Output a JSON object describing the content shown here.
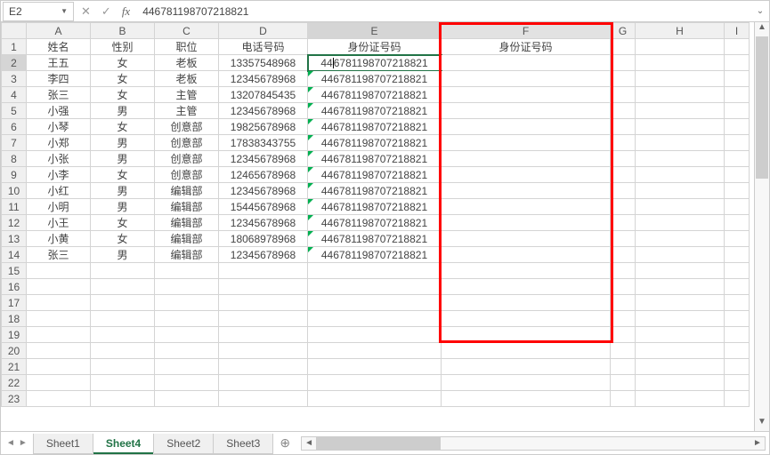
{
  "nameBox": "E2",
  "formula": "446781198707218821",
  "colHeaders": [
    "A",
    "B",
    "C",
    "D",
    "E",
    "F",
    "G",
    "H",
    "I"
  ],
  "rows": [
    {
      "n": 1,
      "A": "姓名",
      "B": "性别",
      "C": "职位",
      "D": "电话号码",
      "E": "身份证号码",
      "F": "身份证号码"
    },
    {
      "n": 2,
      "A": "王五",
      "B": "女",
      "C": "老板",
      "D": "13357548968",
      "E": "446781198707218821"
    },
    {
      "n": 3,
      "A": "李四",
      "B": "女",
      "C": "老板",
      "D": "12345678968",
      "E": "446781198707218821"
    },
    {
      "n": 4,
      "A": "张三",
      "B": "女",
      "C": "主管",
      "D": "13207845435",
      "E": "446781198707218821"
    },
    {
      "n": 5,
      "A": "小强",
      "B": "男",
      "C": "主管",
      "D": "12345678968",
      "E": "446781198707218821"
    },
    {
      "n": 6,
      "A": "小琴",
      "B": "女",
      "C": "创意部",
      "D": "19825678968",
      "E": "446781198707218821"
    },
    {
      "n": 7,
      "A": "小郑",
      "B": "男",
      "C": "创意部",
      "D": "17838343755",
      "E": "446781198707218821"
    },
    {
      "n": 8,
      "A": "小张",
      "B": "男",
      "C": "创意部",
      "D": "12345678968",
      "E": "446781198707218821"
    },
    {
      "n": 9,
      "A": "小李",
      "B": "女",
      "C": "创意部",
      "D": "12465678968",
      "E": "446781198707218821"
    },
    {
      "n": 10,
      "A": "小红",
      "B": "男",
      "C": "编辑部",
      "D": "12345678968",
      "E": "446781198707218821"
    },
    {
      "n": 11,
      "A": "小明",
      "B": "男",
      "C": "编辑部",
      "D": "15445678968",
      "E": "446781198707218821"
    },
    {
      "n": 12,
      "A": "小王",
      "B": "女",
      "C": "编辑部",
      "D": "12345678968",
      "E": "446781198707218821"
    },
    {
      "n": 13,
      "A": "小黄",
      "B": "女",
      "C": "编辑部",
      "D": "18068978968",
      "E": "446781198707218821"
    },
    {
      "n": 14,
      "A": "张三",
      "B": "男",
      "C": "编辑部",
      "D": "12345678968",
      "E": "446781198707218821"
    },
    {
      "n": 15
    },
    {
      "n": 16
    },
    {
      "n": 17
    },
    {
      "n": 18
    },
    {
      "n": 19
    },
    {
      "n": 20
    },
    {
      "n": 21
    },
    {
      "n": 22
    },
    {
      "n": 23
    }
  ],
  "active": {
    "row": 2,
    "col": "E"
  },
  "greenTriRows": [
    3,
    4,
    5,
    6,
    7,
    8,
    9,
    10,
    11,
    12,
    13,
    14
  ],
  "highlight": {
    "col": "F",
    "rowStart": 1,
    "rowEnd": 19
  },
  "tabs": [
    "Sheet1",
    "Sheet4",
    "Sheet2",
    "Sheet3"
  ],
  "activeTab": "Sheet4",
  "icons": {
    "cancel": "✕",
    "enter": "✓",
    "fx": "fx",
    "expand": "⌄",
    "addTab": "⊕",
    "left": "◄",
    "right": "►",
    "up": "▲",
    "down": "▼",
    "ddown": "▼",
    "navL": "◄",
    "navR": "►"
  }
}
